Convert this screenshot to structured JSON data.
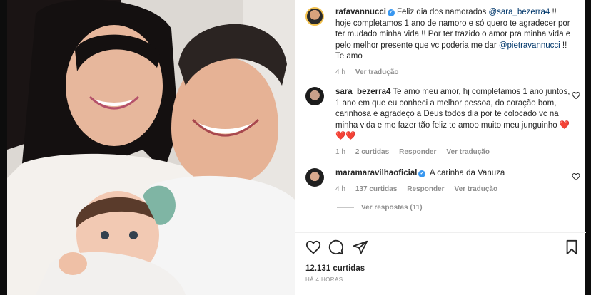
{
  "post": {
    "author": "rafavannucci",
    "caption_pre": "Feliz dia dos namorados ",
    "caption_mention1": "@sara_bezerra4",
    "caption_mid": " !! hoje completamos 1 ano de namoro e só quero te agradecer por ter mudado minha vida !! Por ter trazido o amor pra minha vida e pelo melhor presente que vc poderia me dar ",
    "caption_mention2": "@pietravannucci",
    "caption_post": " !! Te amo",
    "time": "4 h",
    "translate": "Ver tradução"
  },
  "comments": [
    {
      "user": "sara_bezerra4",
      "text": "Te amo meu amor, hj completamos 1 ano juntos, 1 ano em que eu conheci a melhor pessoa, do coração bom, carinhosa e agradeço a Deus todos dia por te colocado vc na minha vida e me fazer tão feliz te amoo muito meu junguinho ❤️❤️❤️",
      "time": "1 h",
      "likes": "2 curtidas",
      "reply": "Responder",
      "translate": "Ver tradução"
    },
    {
      "user": "maramaravilhaoficial",
      "text": "A carinha da Vanuza",
      "time": "4 h",
      "likes": "137 curtidas",
      "reply": "Responder",
      "translate": "Ver tradução",
      "replies_label": "Ver respostas (11)"
    }
  ],
  "footer": {
    "likes": "12.131 curtidas",
    "time": "HÁ 4 HORAS"
  },
  "icons": {
    "like": "heart-icon",
    "comment": "comment-icon",
    "share": "send-icon",
    "save": "bookmark-icon"
  }
}
